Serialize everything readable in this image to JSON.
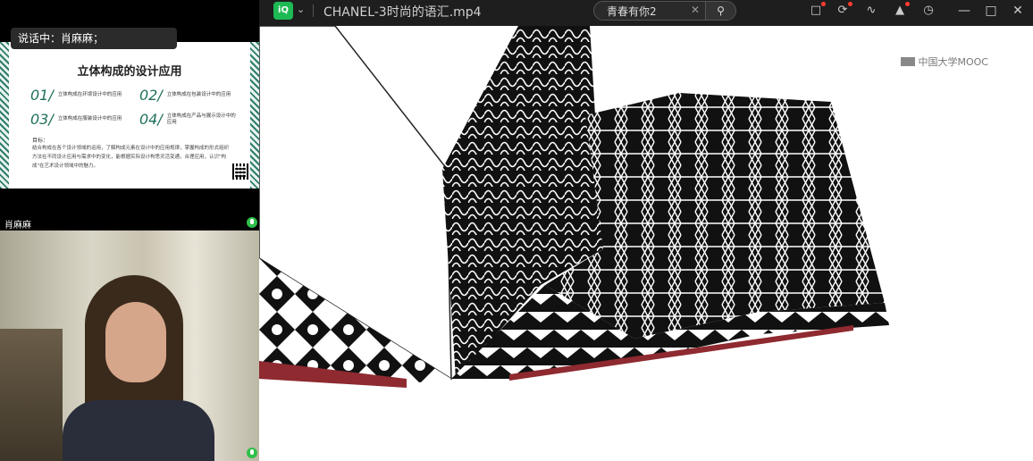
{
  "meeting": {
    "speaking_label": "说话中：肖麻麻；",
    "participant_name": "肖麻麻"
  },
  "slide": {
    "title": "立体构成的设计应用",
    "items": [
      {
        "num": "01/",
        "text": "立体构成在环境设计中的应用"
      },
      {
        "num": "02/",
        "text": "立体构成在包装设计中的应用"
      },
      {
        "num": "03/",
        "text": "立体构成在服装设计中的应用"
      },
      {
        "num": "04/",
        "text": "立体构成在产品与展示设计中的应用"
      }
    ],
    "goal_heading": "目标：",
    "goal_text": "结合构成在各个设计领域的运用，了解构成元素在设计中的应用规律，掌握构成的形式组织方法在不同设计应用与需求中的变化，能根据实际设计构思灵活变通，合理应用，认识\"构成\"在艺术设计领域中的魅力。"
  },
  "player": {
    "app_logo": "iQ",
    "file_title": "CHANEL-3时尚的语汇.mp4",
    "search_value": "青春有你2",
    "icons": [
      "phone-icon",
      "refresh-icon",
      "share-icon",
      "shirt-icon",
      "history-icon"
    ],
    "watermark": "中国大学MOOC"
  },
  "colors": {
    "accent_green": "#1db954",
    "slide_green": "#1f6f5a",
    "badge_red": "#ff3b30"
  }
}
